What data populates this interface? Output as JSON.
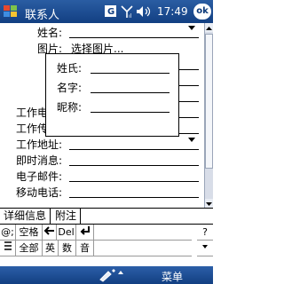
{
  "title_bar": {
    "app_title": "联系人",
    "clock": "17:49",
    "ok_label": "ok"
  },
  "form": {
    "name_label": "姓名:",
    "picture_label": "图片:",
    "picture_value": "选择图片...",
    "work_phone_label": "工作电话:",
    "work_fax_label": "工作传真:",
    "work_address_label": "工作地址:",
    "im_label": "即时消息:",
    "email_label": "电子邮件:",
    "mobile_label": "移动电话:"
  },
  "name_popup": {
    "last_name_label": "姓氏:",
    "first_name_label": "名字:",
    "nickname_label": "昵称:"
  },
  "tabs": {
    "details": "详细信息",
    "notes": "附注"
  },
  "keyboard": {
    "row1": {
      "symbols": "@;",
      "space": "空格",
      "del": "Del",
      "help": "?"
    },
    "row2": {
      "all": "全部",
      "english": "英",
      "numbers": "数",
      "sound": "音"
    }
  },
  "bottom_bar": {
    "menu": "菜单"
  }
}
